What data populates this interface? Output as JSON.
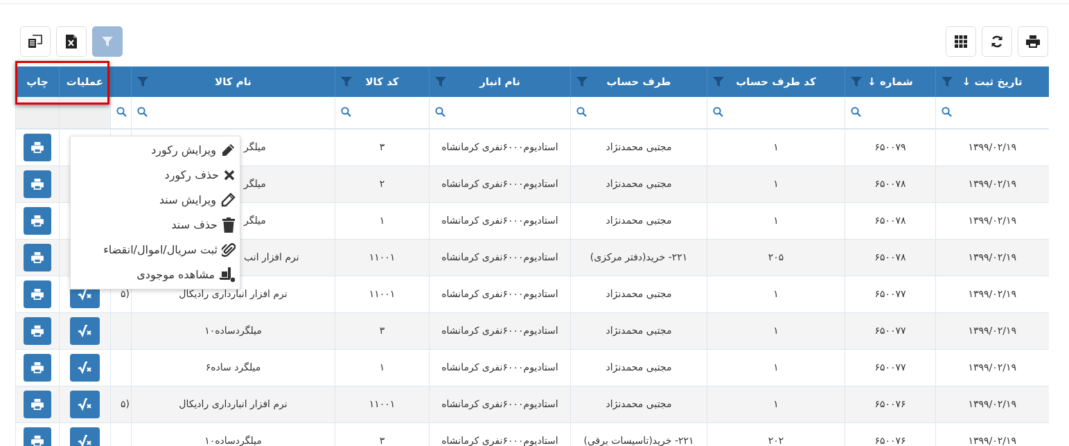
{
  "toolbar": {
    "filter_toggle": {
      "on": true
    }
  },
  "table": {
    "columns": [
      {
        "kind": "text",
        "label": "تاریخ ثبت ↓",
        "filter_icon": true,
        "search": true
      },
      {
        "kind": "text",
        "label": "شماره ↓",
        "filter_icon": true,
        "search": true
      },
      {
        "kind": "text",
        "label": "کد طرف حساب",
        "filter_icon": true,
        "search": true
      },
      {
        "kind": "text",
        "label": "طرف حساب",
        "filter_icon": true,
        "search": true
      },
      {
        "kind": "text",
        "label": "نام انبار",
        "filter_icon": true,
        "search": true
      },
      {
        "kind": "text",
        "label": "کد کالا",
        "filter_icon": true,
        "search": true
      },
      {
        "kind": "text",
        "label": "نام کالا",
        "filter_icon": true,
        "search": true
      },
      {
        "kind": "text",
        "filter_icon": false,
        "search": true
      },
      {
        "kind": "ops",
        "label": "عملیات",
        "filter_icon": false,
        "search": false
      },
      {
        "kind": "print",
        "label": "چاپ",
        "filter_icon": false,
        "search": false
      }
    ],
    "rows": [
      {
        "date": "۱۳۹۹/۰۲/۱۹",
        "number": "۶۵۰۰۷۹",
        "account_code": "۱",
        "account": "مجتبی محمدنژاد",
        "warehouse": "استادیوم۶۰۰۰نفری کرمانشاه",
        "item_code": "۳",
        "item_name": "میلگر"
      },
      {
        "date": "۱۳۹۹/۰۲/۱۹",
        "number": "۶۵۰۰۷۸",
        "account_code": "۱",
        "account": "مجتبی محمدنژاد",
        "warehouse": "استادیوم۶۰۰۰نفری کرمانشاه",
        "item_code": "۲",
        "item_name": "میلگر"
      },
      {
        "date": "۱۳۹۹/۰۲/۱۹",
        "number": "۶۵۰۰۷۸",
        "account_code": "۱",
        "account": "مجتبی محمدنژاد",
        "warehouse": "استادیوم۶۰۰۰نفری کرمانشاه",
        "item_code": "۱",
        "item_name": "میلگر"
      },
      {
        "date": "۱۳۹۹/۰۲/۱۹",
        "number": "۶۵۰۰۷۸",
        "account_code": "۲۰۵",
        "account": "۲۲۱- خرید(دفتر مرکزی)",
        "warehouse": "استادیوم۶۰۰۰نفری کرمانشاه",
        "item_code": "۱۱۰۰۱",
        "item_name": "نرم افزار انب"
      },
      {
        "date": "۱۳۹۹/۰۲/۱۹",
        "number": "۶۵۰۰۷۷",
        "account_code": "۱",
        "account": "مجتبی محمدنژاد",
        "warehouse": "استادیوم۶۰۰۰نفری کرمانشاه",
        "item_code": "۱۱۰۰۱",
        "item_name": "نرم افزار انبارداری رادیکال",
        "column_8": "(۵"
      },
      {
        "date": "۱۳۹۹/۰۲/۱۹",
        "number": "۶۵۰۰۷۷",
        "account_code": "۱",
        "account": "مجتبی محمدنژاد",
        "warehouse": "استادیوم۶۰۰۰نفری کرمانشاه",
        "item_code": "۳",
        "item_name": "میلگردساده۱۰"
      },
      {
        "date": "۱۳۹۹/۰۲/۱۹",
        "number": "۶۵۰۰۷۷",
        "account_code": "۱",
        "account": "مجتبی محمدنژاد",
        "warehouse": "استادیوم۶۰۰۰نفری کرمانشاه",
        "item_code": "۱",
        "item_name": "میلگرد ساده۶"
      },
      {
        "date": "۱۳۹۹/۰۲/۱۹",
        "number": "۶۵۰۰۷۶",
        "account_code": "۱",
        "account": "مجتبی محمدنژاد",
        "warehouse": "استادیوم۶۰۰۰نفری کرمانشاه",
        "item_code": "۱۱۰۰۱",
        "item_name": "نرم افزار انبارداری رادیکال",
        "column_8": "(۵"
      },
      {
        "date": "۱۳۹۹/۰۲/۱۹",
        "number": "۶۵۰۰۷۶",
        "account_code": "۲۰۲",
        "account": "۲۲۱- خرید(تاسیسات برقی)",
        "warehouse": "استادیوم۶۰۰۰نفری کرمانشاه",
        "item_code": "۳",
        "item_name": "میلگردساده۱۰"
      }
    ]
  },
  "context_menu": {
    "items": [
      {
        "kind": "edit_record",
        "label": "ویرایش رکورد"
      },
      {
        "kind": "delete_record",
        "label": "حذف رکورد"
      },
      {
        "kind": "edit_doc",
        "label": "ویرایش سند"
      },
      {
        "kind": "delete_doc",
        "label": "حذف سند"
      },
      {
        "kind": "attach",
        "label": "ثبت سریال/اموال/انقضاء"
      },
      {
        "kind": "stock",
        "label": "مشاهده موجودی"
      }
    ]
  }
}
